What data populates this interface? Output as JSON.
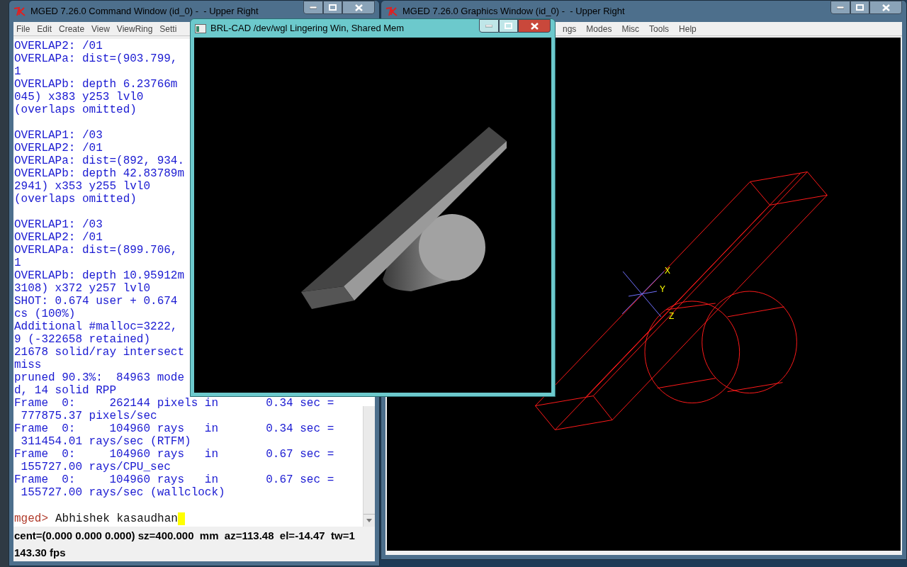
{
  "command_window": {
    "title": "MGED 7.26.0 Command Window (id_0) -  - Upper Right",
    "active": false,
    "menu": [
      "File",
      "Edit",
      "Create",
      "View",
      "ViewRing",
      "Setti"
    ],
    "console_blocks": [
      [
        "OVERLAP2: /01",
        "OVERLAPa: dist=(903.799,",
        "1",
        "OVERLAPb: depth 6.23766m",
        "045) x383 y253 lvl0",
        "(overlaps omitted)"
      ],
      [
        "OVERLAP1: /03",
        "OVERLAP2: /01",
        "OVERLAPa: dist=(892, 934.",
        "OVERLAPb: depth 42.83789m",
        "2941) x353 y255 lvl0",
        "(overlaps omitted)"
      ],
      [
        "OVERLAP1: /03",
        "OVERLAP2: /01",
        "OVERLAPa: dist=(899.706,",
        "1",
        "OVERLAPb: depth 10.95912m",
        "3108) x372 y257 lvl0",
        "SHOT: 0.674 user + 0.674",
        "cs (100%)",
        "Additional #malloc=3222,",
        "9 (-322658 retained)",
        "21678 solid/ray intersect",
        "miss",
        "pruned 90.3%:  84963 mode",
        "d, 14 solid RPP",
        "Frame  0:     262144 pixels in       0.34 sec =",
        " 777875.37 pixels/sec",
        "Frame  0:     104960 rays   in       0.34 sec =",
        " 311454.01 rays/sec (RTFM)",
        "Frame  0:     104960 rays   in       0.67 sec =",
        " 155727.00 rays/CPU_sec",
        "Frame  0:     104960 rays   in       0.67 sec =",
        " 155727.00 rays/sec (wallclock)"
      ]
    ],
    "prompt": "mged>",
    "input": "Abhishek kasaudhan",
    "status_lines": [
      "cent=(0.000 0.000 0.000) sz=400.000  mm  az=113.48  el=-14.47  tw=1",
      "143.30 fps"
    ]
  },
  "graphics_window": {
    "title": "MGED 7.26.0 Graphics Window (id_0) -  - Upper Right",
    "active": false,
    "menu": [
      "ngs",
      "Modes",
      "Misc",
      "Tools",
      "Help"
    ],
    "axis_labels": [
      "X",
      "Y",
      "Z"
    ]
  },
  "lingering_window": {
    "title": "BRL-CAD /dev/wgl Lingering Win, Shared Mem",
    "active": true
  }
}
